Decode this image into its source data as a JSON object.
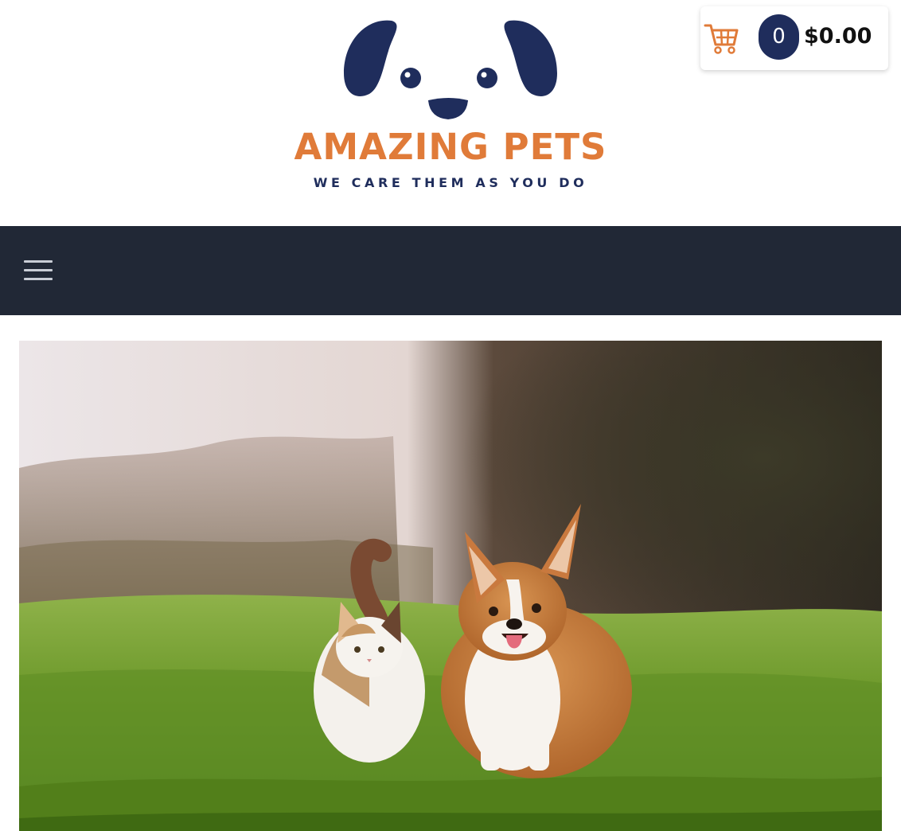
{
  "brand": {
    "name": "AMAZING PETS",
    "tagline": "WE CARE THEM AS YOU DO",
    "colors": {
      "navy": "#1f2d5c",
      "orange": "#e07b39",
      "nav_background": "#212836"
    }
  },
  "cart": {
    "icon": "shopping-cart-icon",
    "count": "0",
    "total": "$0.00"
  },
  "nav": {
    "menu_icon": "hamburger-menu-icon"
  },
  "hero": {
    "image": "photo-of-cat-and-corgi-running-on-grass"
  }
}
